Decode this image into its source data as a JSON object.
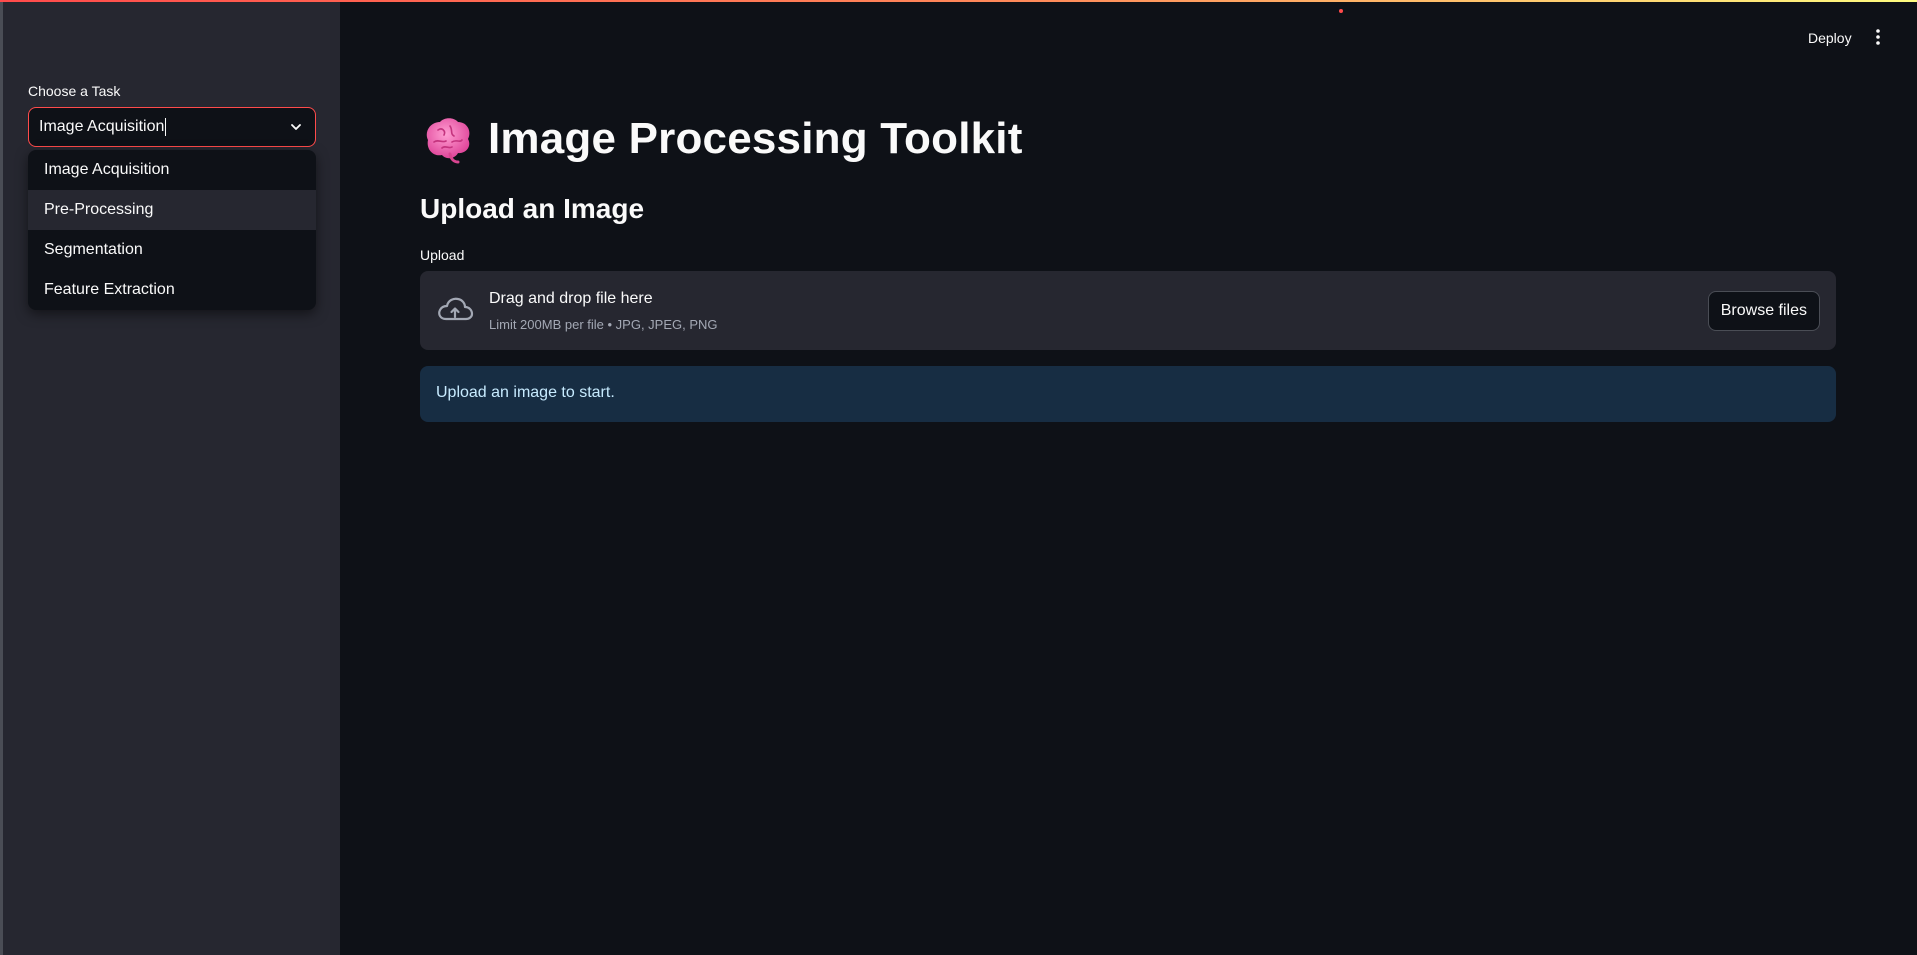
{
  "app": {
    "deploy_label": "Deploy",
    "menu_icon": "kebab-menu-icon"
  },
  "sidebar": {
    "select_label": "Choose a Task",
    "select_value": "Image Acquisition",
    "options": [
      "Image Acquisition",
      "Pre-Processing",
      "Segmentation",
      "Feature Extraction"
    ],
    "highlighted_option": "Pre-Processing"
  },
  "main": {
    "title_icon": "brain-emoji-icon",
    "title": "Image Processing Toolkit",
    "subheader": "Upload an Image",
    "uploader": {
      "label": "Upload",
      "icon": "cloud-upload-icon",
      "instructions": "Drag and drop file here",
      "limits": "Limit 200MB per file • JPG, JPEG, PNG",
      "browse_label": "Browse files"
    },
    "info_message": "Upload an image to start."
  },
  "colors": {
    "background": "#0e1117",
    "sidebar": "#262730",
    "accent": "#ff4b4b",
    "info_bg": "#172d43",
    "info_text": "#c7ebff"
  }
}
